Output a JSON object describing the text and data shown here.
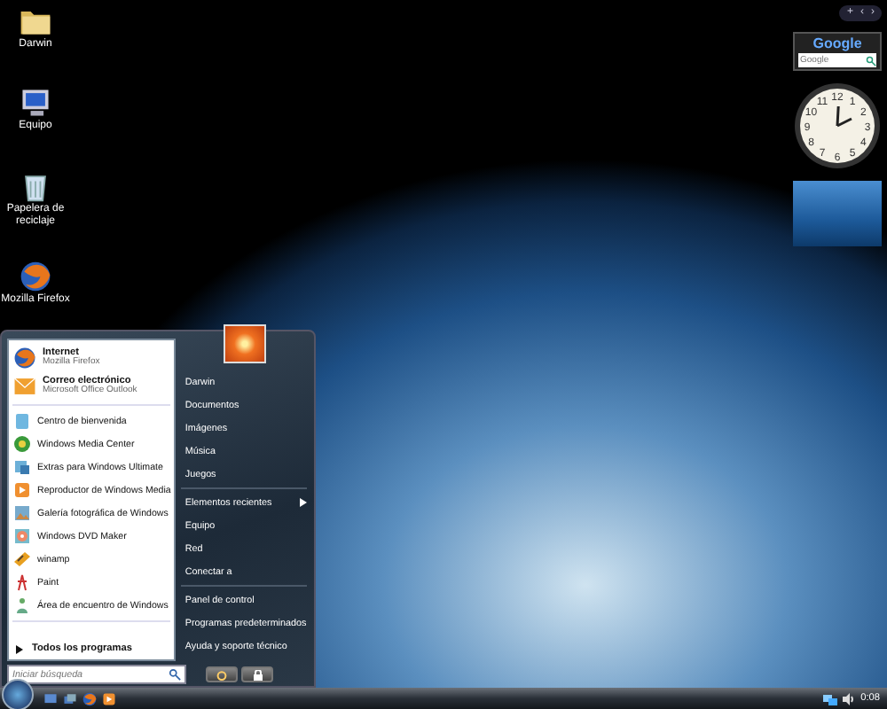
{
  "desktop_icons": [
    {
      "label": "Darwin",
      "kind": "folder"
    },
    {
      "label": "Equipo",
      "kind": "computer"
    },
    {
      "label": "Papelera de reciclaje",
      "kind": "recycle"
    },
    {
      "label": "Mozilla Firefox",
      "kind": "browser"
    }
  ],
  "sidebar": {
    "controls": [
      "+",
      "‹",
      "›"
    ],
    "search_gadget": {
      "logo": "Google",
      "placeholder": "Google"
    },
    "clock": {
      "numerals": [
        "12",
        "11",
        "1",
        "10",
        "2",
        "9",
        "3",
        "8",
        "4",
        "7",
        "5",
        "6"
      ]
    }
  },
  "start_menu": {
    "pinned": [
      {
        "title": "Internet",
        "subtitle": "Mozilla Firefox",
        "kind": "browser"
      },
      {
        "title": "Correo electrónico",
        "subtitle": "Microsoft Office Outlook",
        "kind": "mail"
      }
    ],
    "programs": [
      {
        "label": "Centro de bienvenida",
        "kind": "welcome"
      },
      {
        "label": "Windows Media Center",
        "kind": "media-center"
      },
      {
        "label": "Extras para Windows Ultimate",
        "kind": "extras"
      },
      {
        "label": "Reproductor de Windows Media",
        "kind": "player"
      },
      {
        "label": "Galería fotográfica de Windows",
        "kind": "gallery"
      },
      {
        "label": "Windows DVD Maker",
        "kind": "dvd"
      },
      {
        "label": "winamp",
        "kind": "winamp"
      },
      {
        "label": "Paint",
        "kind": "paint"
      },
      {
        "label": "Área de encuentro de Windows",
        "kind": "meeting"
      }
    ],
    "all_programs": "Todos los programas",
    "search": {
      "placeholder": "Iniciar búsqueda"
    },
    "places": [
      [
        {
          "label": "Darwin",
          "submenu": false
        },
        {
          "label": "Documentos",
          "submenu": false
        },
        {
          "label": "Imágenes",
          "submenu": false
        },
        {
          "label": "Música",
          "submenu": false
        },
        {
          "label": "Juegos",
          "submenu": false
        }
      ],
      [
        {
          "label": "Elementos recientes",
          "submenu": true
        },
        {
          "label": "Equipo",
          "submenu": false
        },
        {
          "label": "Red",
          "submenu": false
        },
        {
          "label": "Conectar a",
          "submenu": false
        }
      ],
      [
        {
          "label": "Panel de control",
          "submenu": false
        },
        {
          "label": "Programas predeterminados",
          "submenu": false
        },
        {
          "label": "Ayuda y soporte técnico",
          "submenu": false
        }
      ]
    ]
  },
  "taskbar": {
    "quick_launch": [
      {
        "kind": "desktop"
      },
      {
        "kind": "window-switch"
      },
      {
        "kind": "browser"
      },
      {
        "kind": "player"
      }
    ],
    "clock": "0:08"
  }
}
